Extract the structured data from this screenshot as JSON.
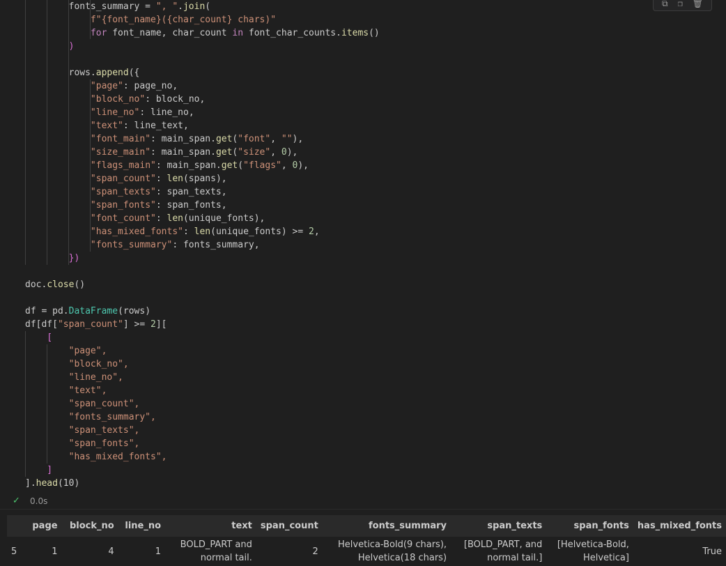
{
  "cell_toolbar": {
    "icons": [
      "run-by-line-icon",
      "copy-icon",
      "delete-icon"
    ]
  },
  "code": {
    "lines": [
      [
        [
          "        fonts_summary = \", \".join(",
          "plain"
        ]
      ],
      [
        [
          "            f\"{font_name}({char_count} chars)\"",
          "str"
        ]
      ],
      [
        [
          "            for font_name, char_count in font_char_counts.items()",
          "plain"
        ]
      ],
      [
        [
          "        )",
          "b2"
        ]
      ],
      [
        [
          "",
          "plain"
        ]
      ],
      [
        [
          "        rows.append({",
          "plain"
        ]
      ],
      [
        [
          "            \"page\": page_no,",
          "plain"
        ]
      ],
      [
        [
          "            \"block_no\": block_no,",
          "plain"
        ]
      ],
      [
        [
          "            \"line_no\": line_no,",
          "plain"
        ]
      ],
      [
        [
          "            \"text\": line_text,",
          "plain"
        ]
      ],
      [
        [
          "            \"font_main\": main_span.get(\"font\", \"\"),",
          "plain"
        ]
      ],
      [
        [
          "            \"size_main\": main_span.get(\"size\", 0),",
          "plain"
        ]
      ],
      [
        [
          "            \"flags_main\": main_span.get(\"flags\", 0),",
          "plain"
        ]
      ],
      [
        [
          "            \"span_count\": len(spans),",
          "plain"
        ]
      ],
      [
        [
          "            \"span_texts\": span_texts,",
          "plain"
        ]
      ],
      [
        [
          "            \"span_fonts\": span_fonts,",
          "plain"
        ]
      ],
      [
        [
          "            \"font_count\": len(unique_fonts),",
          "plain"
        ]
      ],
      [
        [
          "            \"has_mixed_fonts\": len(unique_fonts) >= 2,",
          "plain"
        ]
      ],
      [
        [
          "            \"fonts_summary\": fonts_summary,",
          "plain"
        ]
      ],
      [
        [
          "        })",
          "b2"
        ]
      ],
      [
        [
          "",
          "plain"
        ]
      ],
      [
        [
          "doc.close()",
          "plain"
        ]
      ],
      [
        [
          "",
          "plain"
        ]
      ],
      [
        [
          "df = pd.DataFrame(rows)",
          "plain"
        ]
      ],
      [
        [
          "df[df[\"span_count\"] >= 2][",
          "plain"
        ]
      ],
      [
        [
          "    [",
          "b2"
        ]
      ],
      [
        [
          "        \"page\",",
          "str"
        ]
      ],
      [
        [
          "        \"block_no\",",
          "str"
        ]
      ],
      [
        [
          "        \"line_no\",",
          "str"
        ]
      ],
      [
        [
          "        \"text\",",
          "str"
        ]
      ],
      [
        [
          "        \"span_count\",",
          "str"
        ]
      ],
      [
        [
          "        \"fonts_summary\",",
          "str"
        ]
      ],
      [
        [
          "        \"span_texts\",",
          "str"
        ]
      ],
      [
        [
          "        \"span_fonts\",",
          "str"
        ]
      ],
      [
        [
          "        \"has_mixed_fonts\",",
          "str"
        ]
      ],
      [
        [
          "    ]",
          "b2"
        ]
      ],
      [
        [
          "].head(10)",
          "plain"
        ]
      ]
    ]
  },
  "status": {
    "time": "0.0s"
  },
  "table": {
    "columns": [
      "",
      "page",
      "block_no",
      "line_no",
      "text",
      "span_count",
      "fonts_summary",
      "span_texts",
      "span_fonts",
      "has_mixed_fonts"
    ],
    "rows": [
      {
        "index": "5",
        "page": "1",
        "block_no": "4",
        "line_no": "1",
        "text_1": "BOLD_PART and",
        "text_2": "normal tail.",
        "span_count": "2",
        "fonts_summary_1": "Helvetica-Bold(9 chars),",
        "fonts_summary_2": "Helvetica(18 chars)",
        "span_texts_1": "[BOLD_PART, and",
        "span_texts_2": "normal tail.]",
        "span_fonts_1": "[Helvetica-Bold,",
        "span_fonts_2": "Helvetica]",
        "has_mixed_fonts": "True"
      }
    ]
  }
}
